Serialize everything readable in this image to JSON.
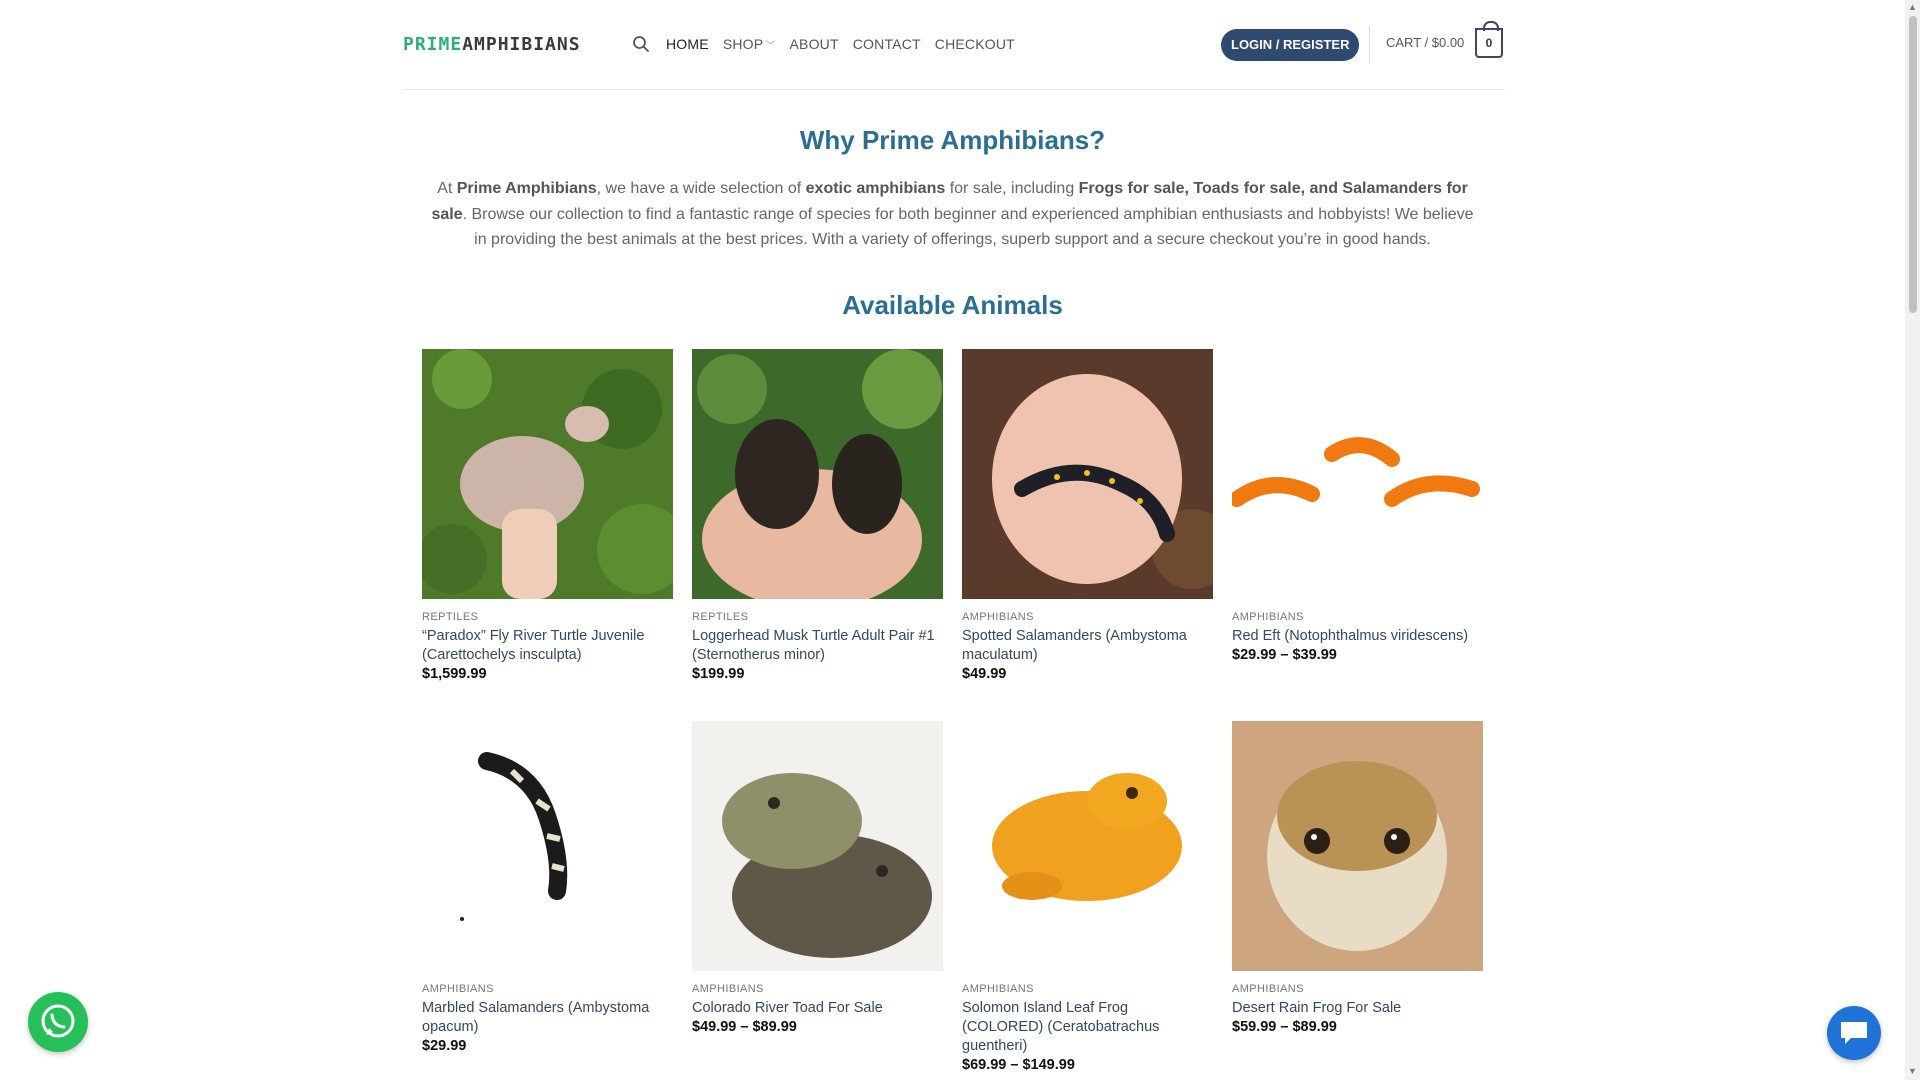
{
  "header": {
    "logo_part1": "PRIME",
    "logo_part2": "AMPHIBIANS",
    "nav": [
      "HOME",
      "SHOP",
      "ABOUT",
      "CONTACT",
      "CHECKOUT"
    ],
    "login": "LOGIN / REGISTER",
    "cart": "CART / $0.00",
    "cart_count": "0"
  },
  "intro": {
    "why_title": "Why Prime Amphibians?",
    "p_at": "At ",
    "p_brand": "Prime Amphibians",
    "p_mid1": ", we have a wide selection of ",
    "p_exotic": "exotic amphibians",
    "p_mid2": " for sale, including ",
    "p_kinds": "Frogs for sale, Toads for sale, and Salamanders for sale",
    "p_rest": ". Browse our collection to find a fantastic range of species for both beginner and experienced amphibian enthusiasts and hobbyists! We believe in providing the best animals at the best prices. With a variety of offerings, superb support and a secure checkout you’re in good hands.",
    "available_title": "Available Animals"
  },
  "products": [
    {
      "category": "REPTILES",
      "name": "“Paradox” Fly River Turtle Juvenile (Carettochelys insculpta)",
      "price": "$1,599.99"
    },
    {
      "category": "REPTILES",
      "name": "Loggerhead Musk Turtle Adult Pair #1 (Sternotherus minor)",
      "price": "$199.99"
    },
    {
      "category": "AMPHIBIANS",
      "name": "Spotted Salamanders (Ambystoma maculatum)",
      "price": "$49.99"
    },
    {
      "category": "AMPHIBIANS",
      "name": "Red Eft (Notophthalmus viridescens)",
      "price": "$29.99 – $39.99"
    },
    {
      "category": "AMPHIBIANS",
      "name": "Marbled Salamanders (Ambystoma opacum)",
      "price": "$29.99"
    },
    {
      "category": "AMPHIBIANS",
      "name": "Colorado River Toad For Sale",
      "price": "$49.99 – $89.99"
    },
    {
      "category": "AMPHIBIANS",
      "name": "Solomon Island Leaf Frog (COLORED) (Ceratobatrachus guentheri)",
      "price": "$69.99 – $149.99"
    },
    {
      "category": "AMPHIBIANS",
      "name": "Desert Rain Frog For Sale",
      "price": "$59.99 – $89.99"
    }
  ],
  "colors": {
    "accent": "#2a6f93",
    "logo_green": "#2eae7a",
    "login_bg": "#2e4a6e",
    "whatsapp": "#25c05a",
    "chat": "#1f73d6"
  },
  "icons": [
    "search-icon",
    "chevron-down-icon",
    "whatsapp-icon",
    "chat-icon"
  ]
}
